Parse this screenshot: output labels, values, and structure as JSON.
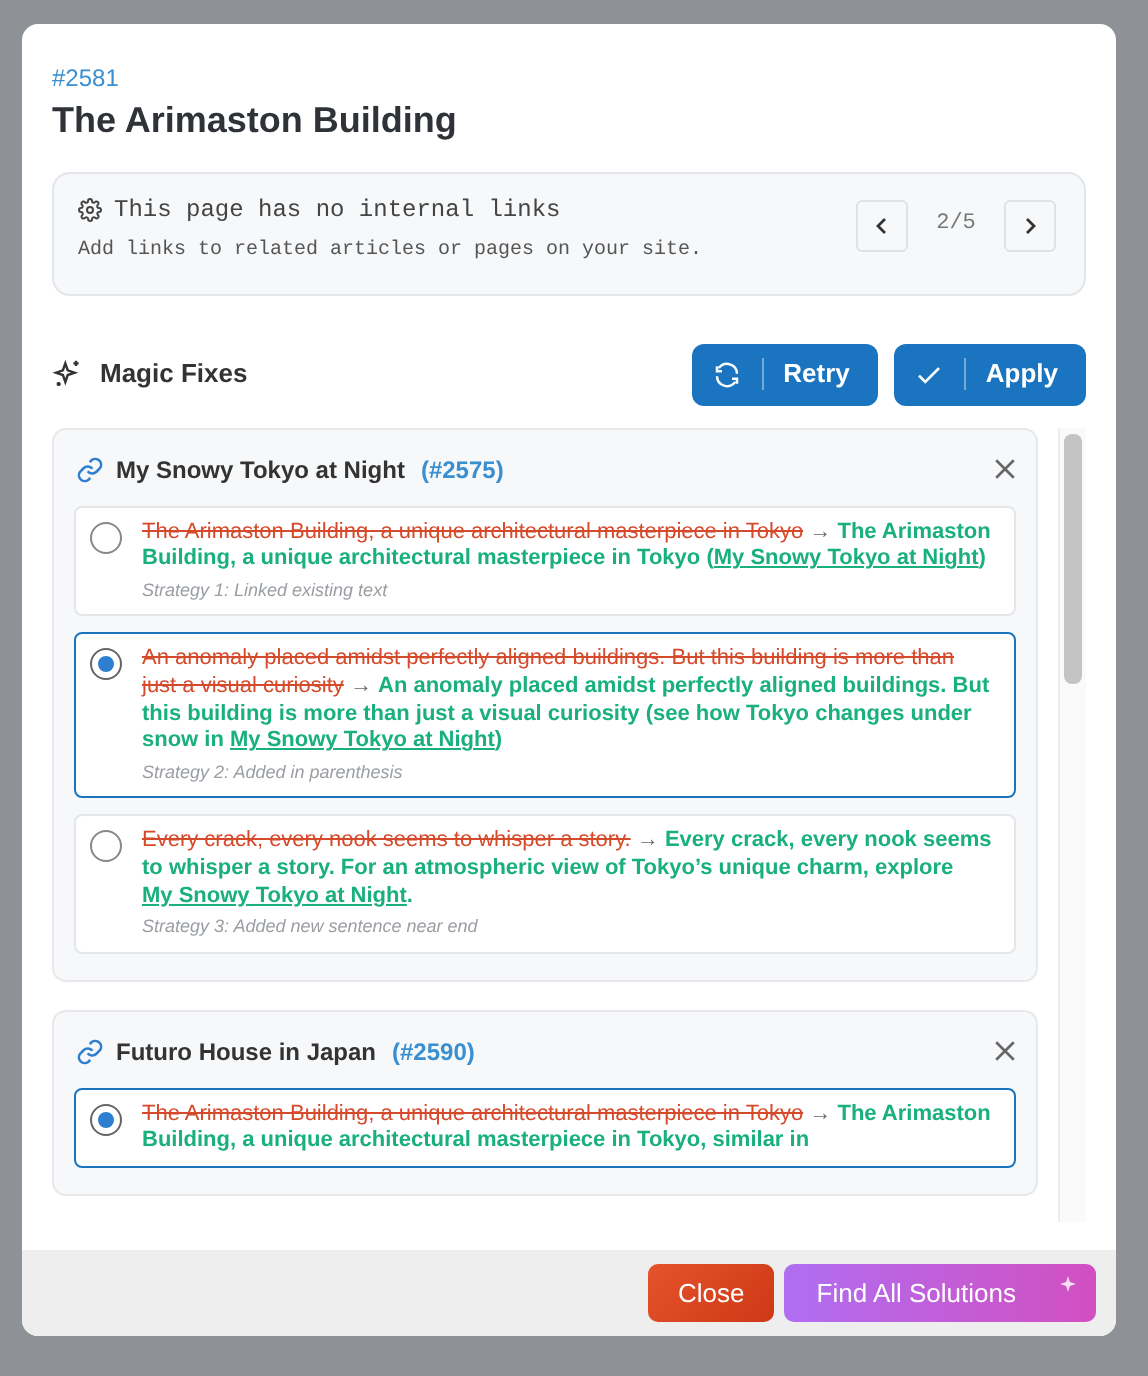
{
  "modal": {
    "id": "#2581",
    "title": "The Arimaston Building",
    "notice": {
      "heading": "This page has no internal links",
      "text": "Add links to related articles or pages on your site.",
      "pager": "2/5"
    },
    "section": "Magic Fixes",
    "actions": [
      "Retry",
      "Apply"
    ],
    "groups": [
      {
        "title": "My Snowy Tokyo at Night",
        "ref": "(#2575)",
        "options": [
          {
            "selected": false,
            "old": "The Arimaston Building, a unique architectural masterpiece in Tokyo",
            "arrow": "→",
            "new": "The Arimaston Building, a unique architectural masterpiece in Tokyo (",
            "link": "My Snowy Tokyo at Night",
            "after": ")",
            "strategy": "Strategy 1: Linked existing text"
          },
          {
            "selected": true,
            "old": "An anomaly placed amidst perfectly aligned buildings. But this building is more than just a visual curiosity",
            "arrow": "→",
            "new": "An anomaly placed amidst perfectly aligned buildings. But this building is more than just a visual curiosity (see how Tokyo changes under snow in ",
            "link": "My Snowy Tokyo at Night",
            "after": ")",
            "strategy": "Strategy 2: Added in parenthesis"
          },
          {
            "selected": false,
            "old": "Every crack, every nook seems to whisper a story.",
            "arrow": "→",
            "new": "Every crack, every nook seems to whisper a story. For an atmospheric view of Tokyo’s unique charm, explore ",
            "link": "My Snowy Tokyo at Night",
            "after": ".",
            "strategy": "Strategy 3: Added new sentence near end"
          }
        ]
      },
      {
        "title": "Futuro House in Japan",
        "ref": "(#2590)",
        "options": [
          {
            "selected": true,
            "old": "The Arimaston Building, a unique architectural masterpiece in Tokyo",
            "arrow": "→",
            "new": "The Arimaston Building, a unique architectural masterpiece in Tokyo, similar in"
          }
        ]
      }
    ],
    "footer": [
      "Close",
      "Find All Solutions"
    ]
  }
}
